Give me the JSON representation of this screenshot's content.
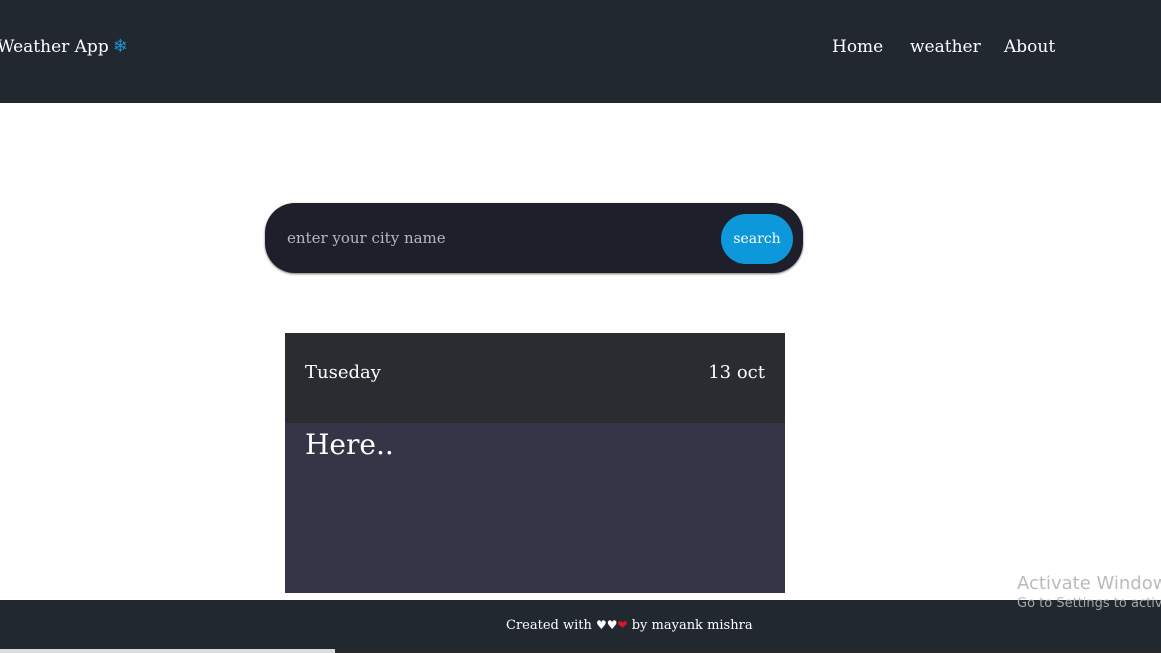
{
  "navbar": {
    "brand": "Weather App",
    "brand_icon": "snowflake-icon",
    "links": [
      {
        "label": "Home"
      },
      {
        "label": "weather"
      },
      {
        "label": "About"
      }
    ]
  },
  "search": {
    "placeholder": "enter your city name",
    "value": "",
    "button_label": "search"
  },
  "card": {
    "day": "Tuseday",
    "date": "13 oct",
    "body": "Here.."
  },
  "footer": {
    "prefix": "Created with",
    "hearts": "♥♥",
    "heart_red": "❤",
    "suffix": "by mayank mishra"
  },
  "watermark": {
    "title": "Activate Window",
    "subtitle": "Go to Settings to activ"
  },
  "colors": {
    "navbar_bg": "#212830",
    "accent": "#0d98db",
    "card_header_bg": "#2b2c31",
    "card_body_bg": "#343648"
  }
}
